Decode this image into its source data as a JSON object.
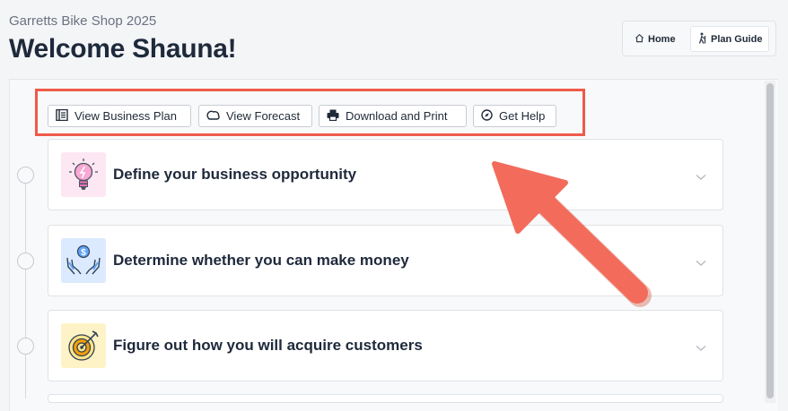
{
  "header": {
    "subtitle": "Garretts Bike Shop 2025",
    "title": "Welcome Shauna!"
  },
  "topnav": {
    "home_label": "Home",
    "guide_label": "Plan Guide"
  },
  "actions": [
    {
      "label": "View Business Plan",
      "icon": "notebook-icon"
    },
    {
      "label": "View Forecast",
      "icon": "forecast-icon"
    },
    {
      "label": "Download and Print",
      "icon": "printer-icon"
    },
    {
      "label": "Get Help",
      "icon": "compass-icon"
    }
  ],
  "steps": [
    {
      "label": "Define your business opportunity",
      "icon": "lightbulb-icon"
    },
    {
      "label": "Determine whether you can make money",
      "icon": "money-hands-icon"
    },
    {
      "label": "Figure out how you will acquire customers",
      "icon": "target-icon"
    }
  ],
  "colors": {
    "highlight": "#ef5a4a",
    "arrow": "#f26b5b",
    "page_bg": "#f4f5f7"
  }
}
